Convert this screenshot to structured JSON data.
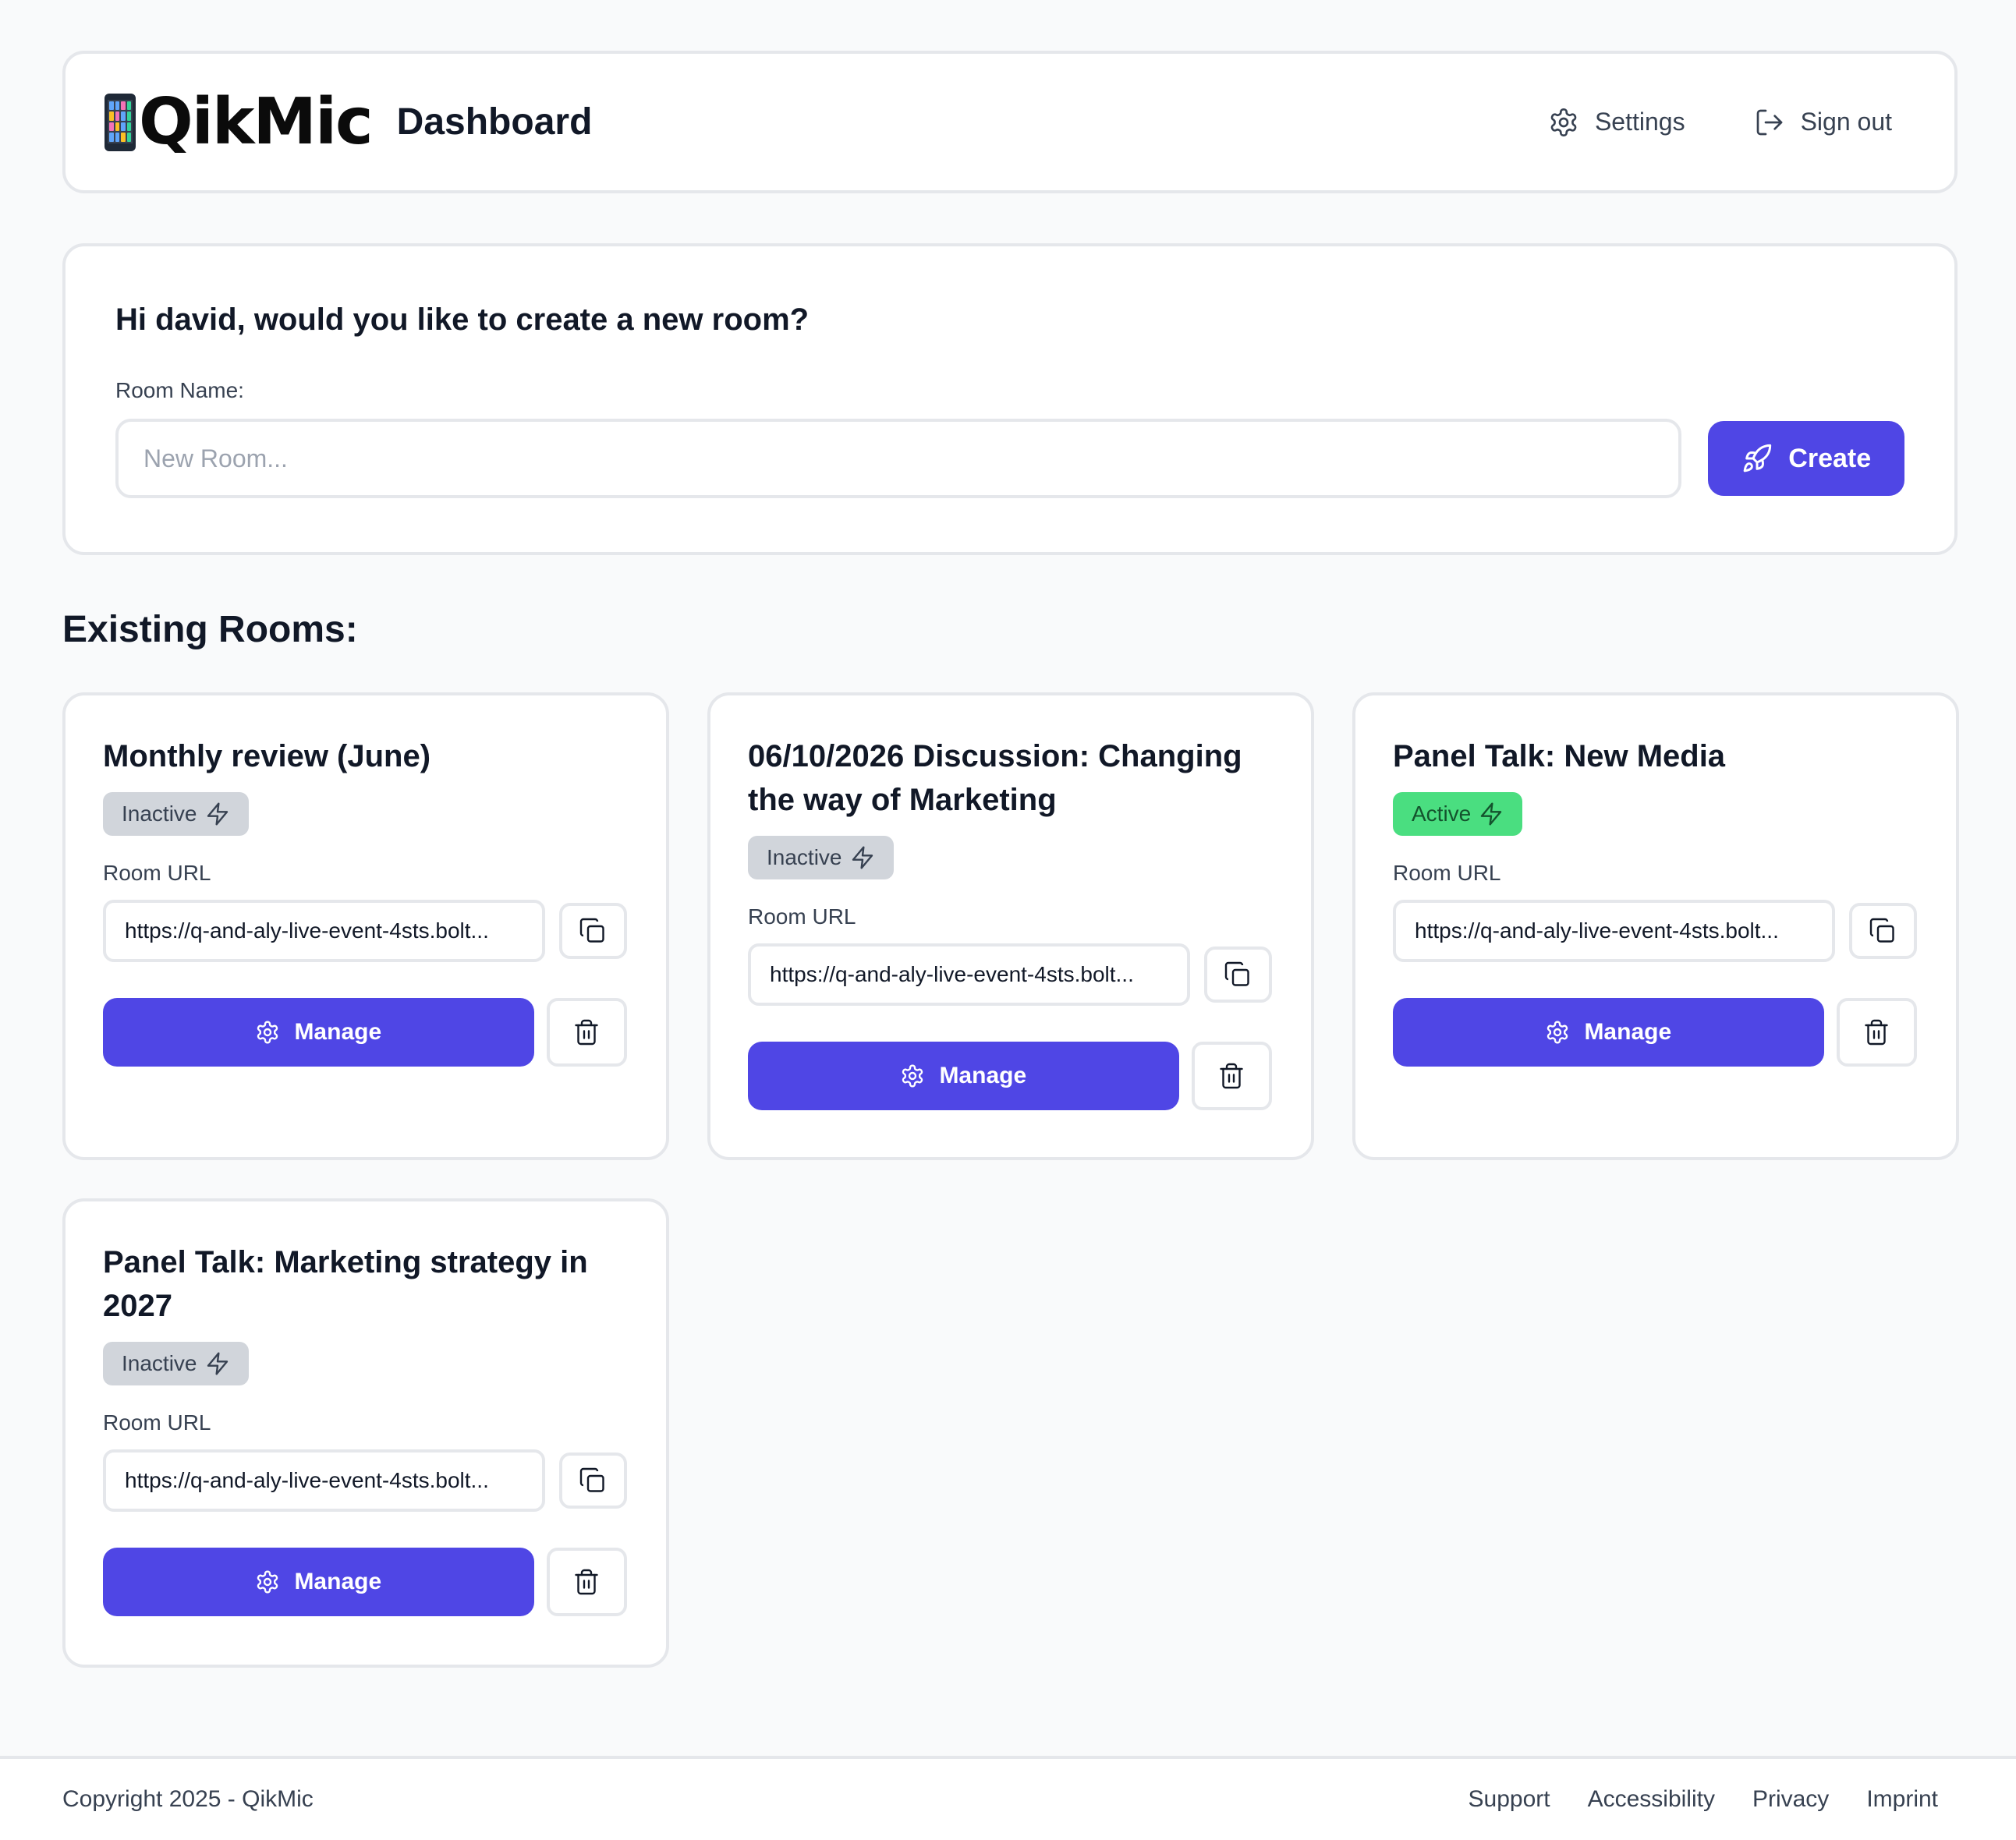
{
  "header": {
    "logo_text": "QikMic",
    "page_title": "Dashboard",
    "settings_label": "Settings",
    "signout_label": "Sign out"
  },
  "create": {
    "greeting": "Hi david, would you like to create a new room?",
    "field_label": "Room Name:",
    "placeholder": "New Room...",
    "button_label": "Create"
  },
  "rooms_section": {
    "title": "Existing Rooms:",
    "url_label": "Room URL",
    "manage_label": "Manage"
  },
  "rooms": [
    {
      "title": "Monthly review (June)",
      "status": "Inactive",
      "url": "https://q-and-aly-live-event-4sts.bolt..."
    },
    {
      "title": "06/10/2026 Discussion: Changing the way of Marketing",
      "status": "Inactive",
      "url": "https://q-and-aly-live-event-4sts.bolt..."
    },
    {
      "title": "Panel Talk: New Media",
      "status": "Active",
      "url": "https://q-and-aly-live-event-4sts.bolt..."
    },
    {
      "title": "Panel Talk: Marketing strategy in 2027",
      "status": "Inactive",
      "url": "https://q-and-aly-live-event-4sts.bolt..."
    }
  ],
  "footer": {
    "copyright": "Copyright 2025 - QikMic",
    "links": [
      "Support",
      "Accessibility",
      "Privacy",
      "Imprint"
    ]
  },
  "colors": {
    "primary": "#4f46e5",
    "active_badge": "#4ade80",
    "inactive_badge": "#d1d5db",
    "border": "#e5e7eb",
    "background": "#f9fafb"
  },
  "icons": {
    "logo": "mobile-phone-icon",
    "settings": "gear-icon",
    "signout": "sign-out-icon",
    "create": "rocket-icon",
    "status": "lightning-icon",
    "copy": "copy-icon",
    "manage": "gear-icon",
    "delete": "trash-icon"
  }
}
